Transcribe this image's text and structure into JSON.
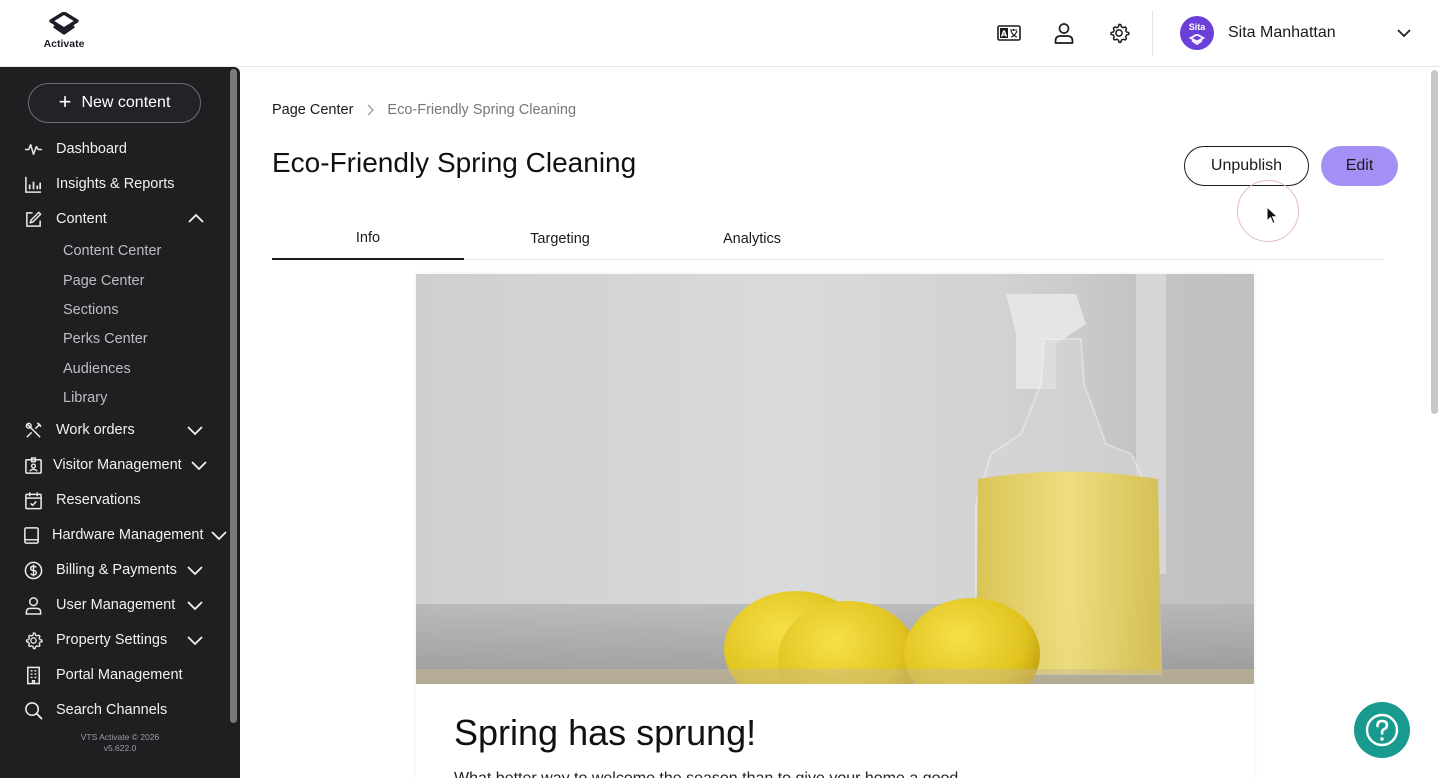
{
  "app": {
    "logo_text": "Activate",
    "version_line1": "VTS Activate © 2026",
    "version_line2": "v5.622.0"
  },
  "header": {
    "icons": [
      "translate-icon",
      "person-icon",
      "gear-icon"
    ],
    "user": {
      "initials": "Sita",
      "name": "Sita Manhattan"
    }
  },
  "sidebar": {
    "new_content": "New content",
    "items": [
      {
        "label": "Dashboard",
        "icon": "pulse-icon"
      },
      {
        "label": "Insights & Reports",
        "icon": "bar-chart-icon"
      },
      {
        "label": "Content",
        "icon": "edit-icon",
        "expanded": true
      },
      {
        "label": "Work orders",
        "icon": "tools-icon"
      },
      {
        "label": "Visitor Management",
        "icon": "badge-icon"
      },
      {
        "label": "Reservations",
        "icon": "calendar-icon"
      },
      {
        "label": "Hardware Management",
        "icon": "tablet-icon"
      },
      {
        "label": "Billing & Payments",
        "icon": "dollar-icon"
      },
      {
        "label": "User Management",
        "icon": "person-icon"
      },
      {
        "label": "Property Settings",
        "icon": "gear-icon"
      },
      {
        "label": "Portal Management",
        "icon": "building-icon"
      },
      {
        "label": "Search Channels",
        "icon": "search-icon"
      }
    ],
    "content_sub": [
      "Content Center",
      "Page Center",
      "Sections",
      "Perks Center",
      "Audiences",
      "Library"
    ]
  },
  "main": {
    "breadcrumb": {
      "parent": "Page Center",
      "current": "Eco-Friendly Spring Cleaning"
    },
    "title": "Eco-Friendly Spring Cleaning",
    "actions": {
      "unpublish": "Unpublish",
      "edit": "Edit"
    },
    "tabs": [
      "Info",
      "Targeting",
      "Analytics"
    ],
    "active_tab": "Info",
    "card": {
      "heading": "Spring has sprung!",
      "body": "What better way to welcome the season than to give your home a good"
    }
  },
  "colors": {
    "sidebar_bg": "#1f1f22",
    "accent": "#a490f5",
    "avatar": "#6a40d9",
    "help": "#199a8e"
  }
}
